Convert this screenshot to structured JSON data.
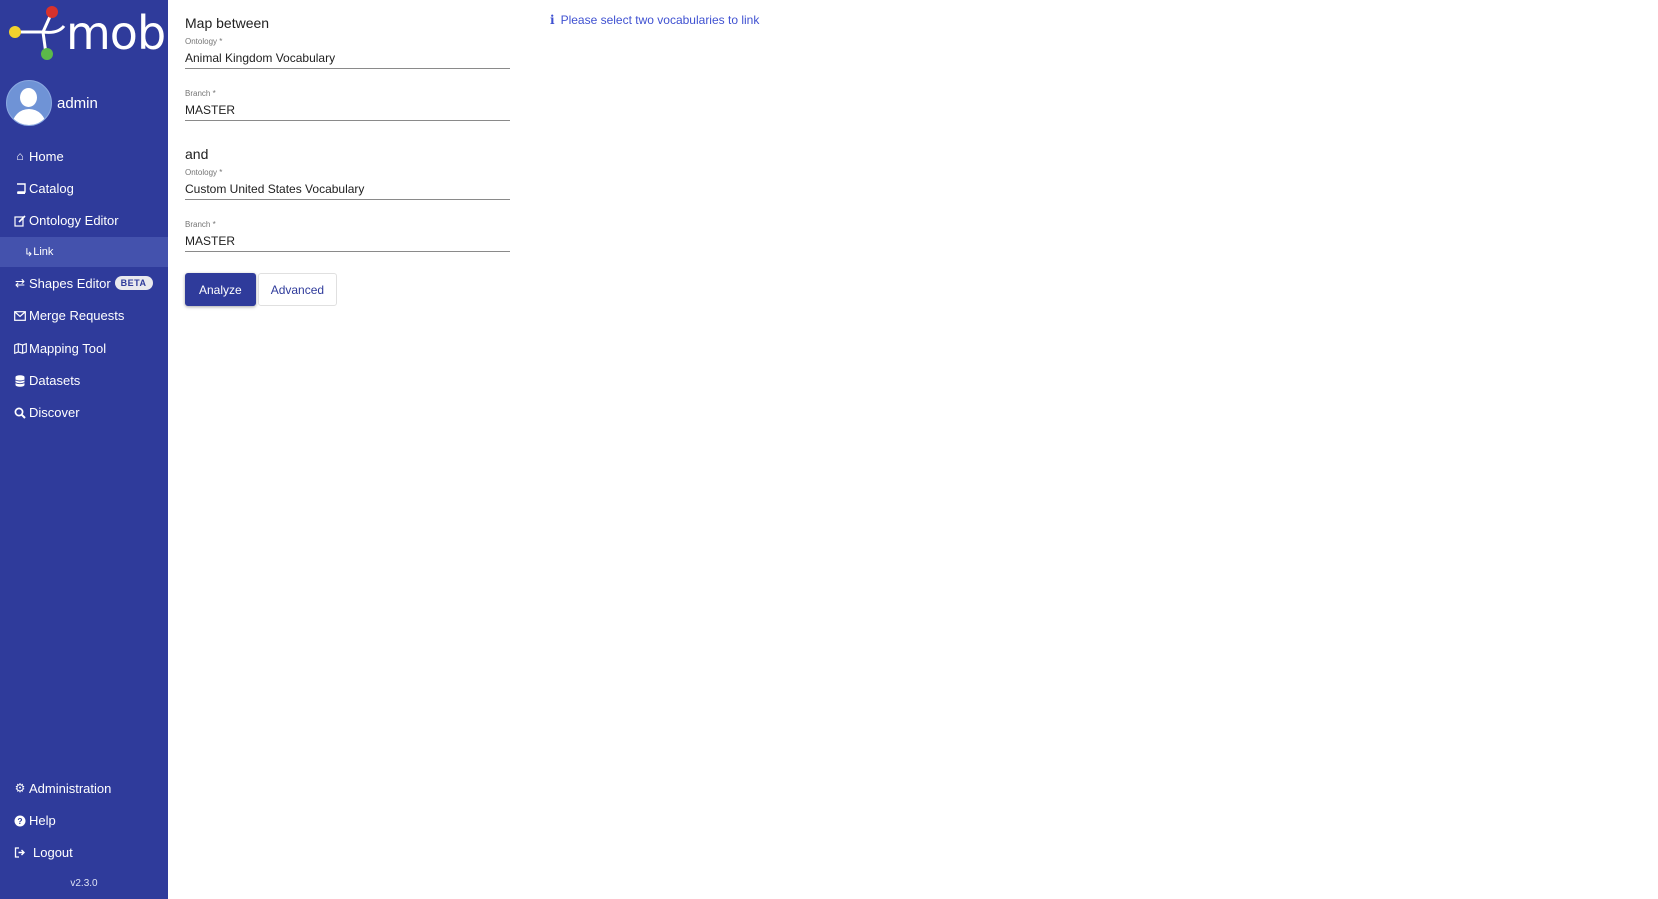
{
  "app": {
    "name": "mobi",
    "version": "v2.3.0"
  },
  "colors": {
    "sidebar_bg": "#2f3b9b",
    "primary": "#2f3b9b",
    "info_text": "#3f51d1",
    "active_sub_bg": "#4452ad"
  },
  "user": {
    "name": "admin"
  },
  "sidebar": {
    "items": [
      {
        "label": "Home",
        "icon": "home-icon"
      },
      {
        "label": "Catalog",
        "icon": "book-icon"
      },
      {
        "label": "Ontology Editor",
        "icon": "edit-icon"
      },
      {
        "label": "Shapes Editor",
        "icon": "shapes-icon",
        "badge": "BETA"
      },
      {
        "label": "Merge Requests",
        "icon": "envelope-icon"
      },
      {
        "label": "Mapping Tool",
        "icon": "map-icon"
      },
      {
        "label": "Datasets",
        "icon": "database-icon"
      },
      {
        "label": "Discover",
        "icon": "search-icon"
      }
    ],
    "sub_item": {
      "label": "Link",
      "icon": "return-arrow-icon"
    },
    "bottom_items": [
      {
        "label": "Administration",
        "icon": "gear-icon"
      },
      {
        "label": "Help",
        "icon": "help-icon"
      },
      {
        "label": "Logout",
        "icon": "logout-icon"
      }
    ]
  },
  "main": {
    "map_between_label": "Map between",
    "and_label": "and",
    "ontology1": {
      "caption": "Ontology *",
      "value": "Animal Kingdom Vocabulary"
    },
    "branch1": {
      "caption": "Branch *",
      "value": "MASTER"
    },
    "ontology2": {
      "caption": "Ontology *",
      "value": "Custom United States Vocabulary"
    },
    "branch2": {
      "caption": "Branch *",
      "value": "MASTER"
    },
    "analyze_label": "Analyze",
    "advanced_label": "Advanced",
    "info_message": "Please select two vocabularies to link"
  }
}
